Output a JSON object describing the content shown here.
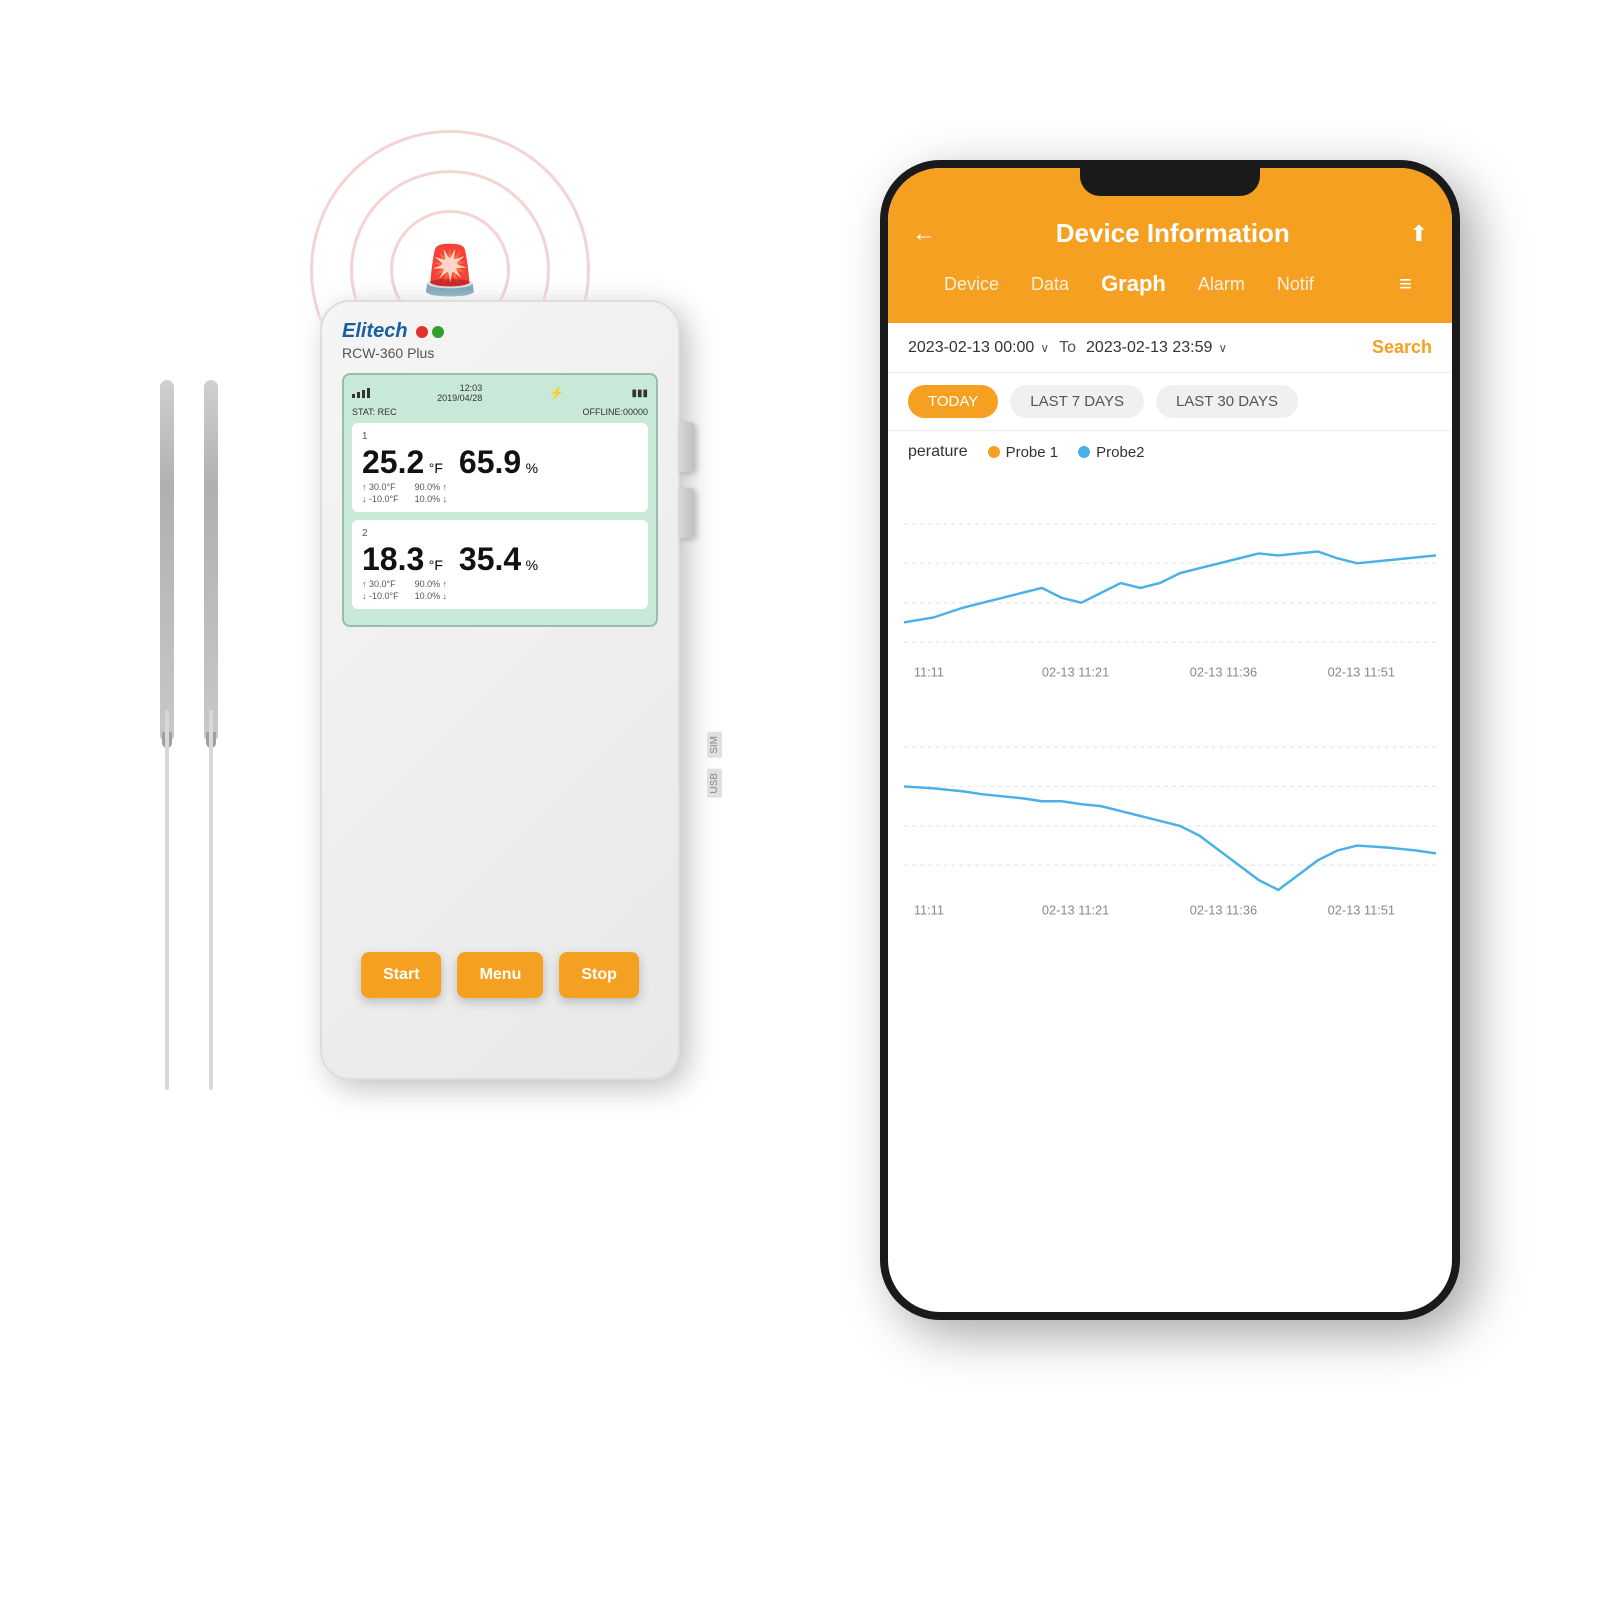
{
  "app": {
    "title": "Device Information",
    "back_label": "←",
    "share_label": "⬆",
    "tabs": [
      {
        "id": "device",
        "label": "Device",
        "active": false
      },
      {
        "id": "data",
        "label": "Data",
        "active": false
      },
      {
        "id": "graph",
        "label": "Graph",
        "active": true
      },
      {
        "id": "alarm",
        "label": "Alarm",
        "active": false
      },
      {
        "id": "notif",
        "label": "Notif",
        "active": false
      }
    ],
    "date_from": "2023-02-13 00:00",
    "date_to": "2023-02-13 23:59",
    "search_label": "Search",
    "filters": [
      {
        "label": "TODAY",
        "active": true
      },
      {
        "label": "LAST 7 DAYS",
        "active": false
      },
      {
        "label": "LAST 30 DAYS",
        "active": false
      }
    ],
    "graph_section_label": "perature",
    "legend": [
      {
        "label": "Probe 1",
        "color": "orange"
      },
      {
        "label": "Probe2",
        "color": "blue"
      }
    ],
    "x_axis_labels_top": [
      "11:11",
      "02-13 11:21",
      "02-13 11:36",
      "02-13 11:51"
    ],
    "x_axis_labels_bottom": [
      "11:11",
      "02-13 11:21",
      "02-13 11:36",
      "02-13 11:51"
    ]
  },
  "device": {
    "brand": "Elitech",
    "model": "RCW-360 Plus",
    "status": "STAT: REC",
    "offline": "OFFLINE:00000",
    "time": "12:03",
    "date": "2019/04/28",
    "sensor1": {
      "id": "1",
      "temp": "25.2",
      "temp_unit": "°F",
      "humidity": "65.9",
      "hum_unit": "%",
      "high_temp": "30.0°F",
      "low_temp": "-10.0°F",
      "high_hum": "90.0%",
      "low_hum": "10.0%"
    },
    "sensor2": {
      "id": "2",
      "temp": "18.3",
      "temp_unit": "°F",
      "humidity": "35.4",
      "hum_unit": "%",
      "high_temp": "30.0°F",
      "low_temp": "-10.0°F",
      "high_hum": "90.0%",
      "low_hum": "10.0%"
    },
    "buttons": [
      "Start",
      "Menu",
      "Stop"
    ],
    "slots": [
      "SIM",
      "USB"
    ]
  },
  "colors": {
    "orange": "#f5a020",
    "blue": "#4ab0e8",
    "device_bg": "#f0f0f0",
    "screen_bg": "#c8e8d8"
  }
}
